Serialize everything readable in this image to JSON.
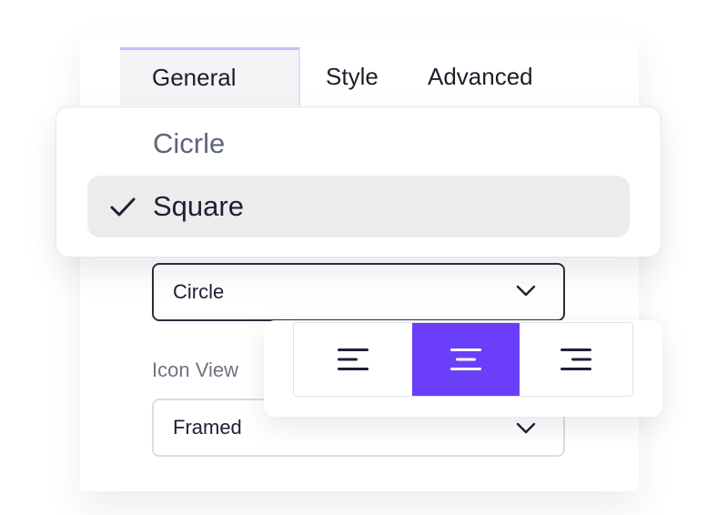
{
  "tabs": [
    {
      "label": "General",
      "active": true
    },
    {
      "label": "Style",
      "active": false
    },
    {
      "label": "Advanced",
      "active": false
    }
  ],
  "shape_menu": {
    "options": [
      {
        "label": "Cicrle",
        "selected": false
      },
      {
        "label": "Square",
        "selected": true
      }
    ]
  },
  "shape_select": {
    "value": "Circle"
  },
  "icon_view": {
    "label": "Icon View",
    "value": "Framed"
  },
  "alignment": {
    "options": [
      {
        "icon": "align-left-icon",
        "active": false
      },
      {
        "icon": "align-center-icon",
        "active": true
      },
      {
        "icon": "align-right-icon",
        "active": false
      }
    ]
  },
  "colors": {
    "accent": "#6b3ffa",
    "tab_indicator": "#c7bff7",
    "icon_dark": "#1b2133"
  }
}
